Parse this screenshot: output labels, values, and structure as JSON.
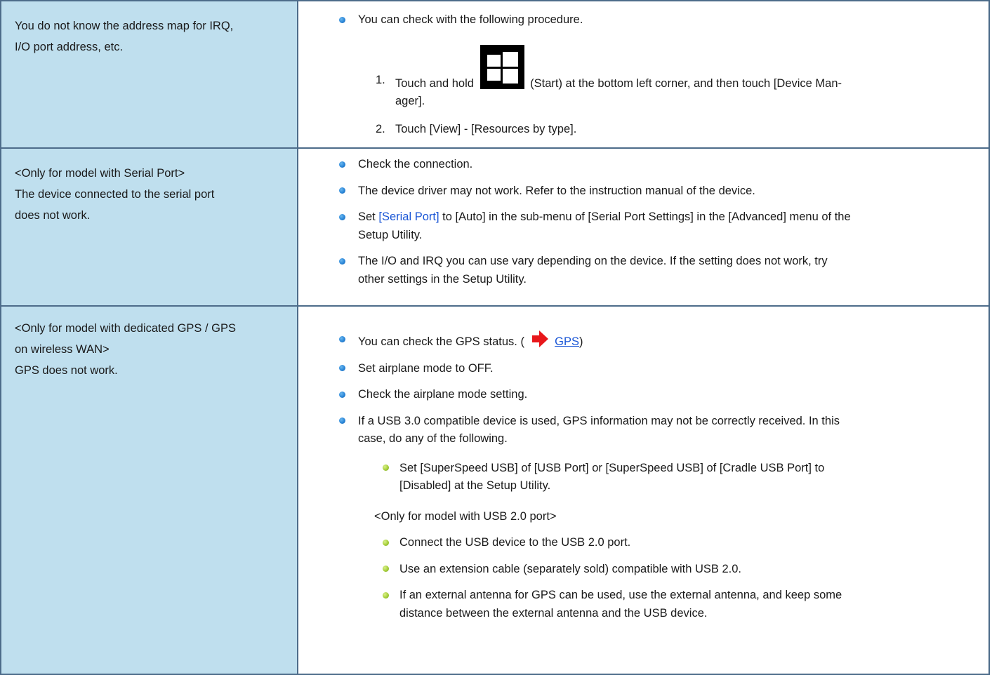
{
  "rows": [
    {
      "problem": [
        "You do not know the address map for IRQ,",
        "I/O port address, etc."
      ],
      "bullet": "You can check with the following procedure.",
      "steps": [
        {
          "num": "1.",
          "pre": "Touch and hold",
          "icon": "windows-start-icon",
          "post1": "(Start) at the bottom left corner, and then touch [Device Man-",
          "post2": "ager]."
        },
        {
          "num": "2.",
          "text": "Touch [View] - [Resources by type]."
        }
      ]
    },
    {
      "problem": [
        "<Only for model with Serial Port>",
        "The device connected to the serial port",
        "does not work."
      ],
      "bullets": [
        "Check the connection.",
        "The device driver may not work. Refer to the instruction manual of the device.",
        {
          "pre": "Set ",
          "link": "[Serial Port]",
          "post1": " to [Auto] in the sub-menu of [Serial Port Settings] in the [Advanced] menu of the",
          "post2": "Setup Utility."
        },
        {
          "line1": "The I/O and IRQ you can use vary depending on the device. If the setting does not work, try",
          "line2": "other settings in the Setup Utility."
        }
      ]
    },
    {
      "problem": [
        "<Only for model with dedicated GPS / GPS",
        "on wireless WAN>",
        "GPS does not work."
      ],
      "bullets": [
        {
          "pre": "You can check the GPS status. (",
          "icon": "red-arrow-icon",
          "link": "GPS",
          "post": ")"
        },
        "Set airplane mode to OFF.",
        "Check the airplane mode setting.",
        {
          "line1": "If a USB 3.0 compatible device is used, GPS information may not be correctly received. In this",
          "line2": "case, do any of the following."
        }
      ],
      "sub1": {
        "line1": "Set [SuperSpeed USB] of [USB Port] or [SuperSpeed USB] of [Cradle USB Port] to",
        "line2": "[Disabled] at the Setup Utility."
      },
      "usb2_note": "<Only for model with USB 2.0 port>",
      "sub2": [
        "Connect the USB device to the USB 2.0 port.",
        "Use an extension cable (separately sold) compatible with USB 2.0.",
        {
          "line1": "If an external antenna for GPS can be used, use the external antenna, and keep some",
          "line2": "distance between the external antenna and the USB device."
        }
      ]
    }
  ],
  "colors": {
    "problem_bg": "#bfdfee",
    "border": "#4d6c8a",
    "link": "#1a56d6",
    "bullet_blue": "#2a86d8",
    "bullet_green": "#a6cf3a"
  }
}
